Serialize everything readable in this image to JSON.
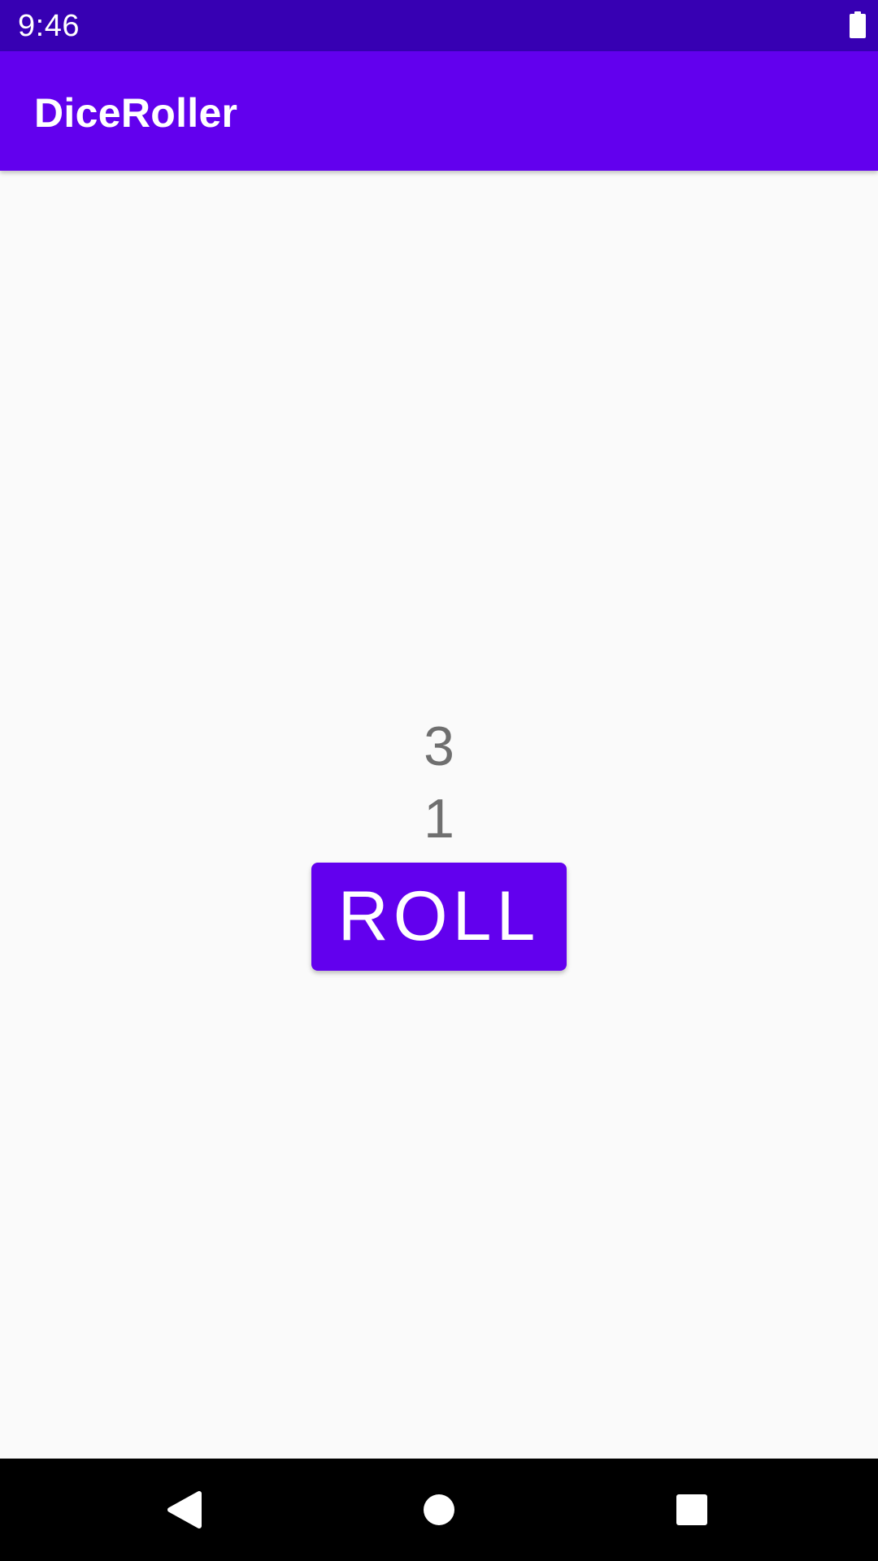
{
  "status_bar": {
    "time": "9:46",
    "icons": [
      "battery-icon"
    ]
  },
  "app_bar": {
    "title": "DiceRoller"
  },
  "main": {
    "dice_values": [
      "3",
      "1"
    ],
    "roll_button_label": "ROLL"
  },
  "nav_bar": {
    "icons": [
      "back-icon",
      "home-icon",
      "recents-icon"
    ]
  },
  "colors": {
    "status_bar": "#3700b3",
    "primary": "#6200ee",
    "background": "#fafafa",
    "dice_text": "#6f6f6f"
  }
}
